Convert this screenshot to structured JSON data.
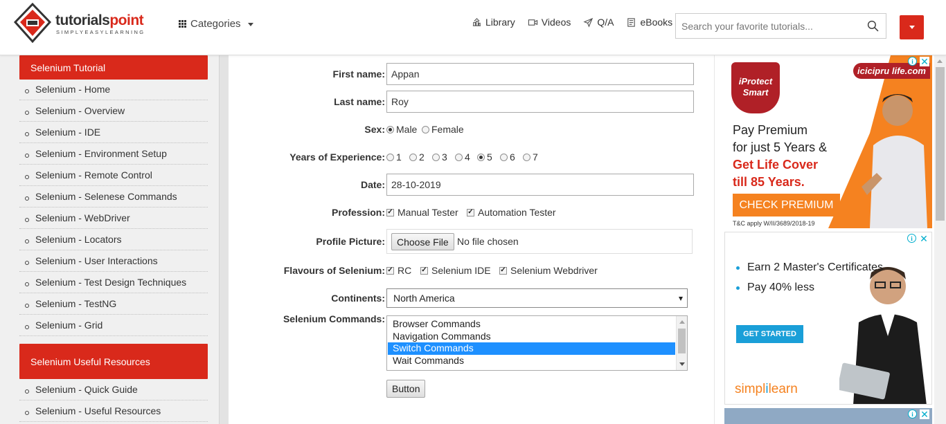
{
  "header": {
    "logo_main_a": "tutorials",
    "logo_main_b": "point",
    "logo_sub": "SIMPLYEASYLEARNING",
    "categories_label": "Categories",
    "nav": [
      {
        "label": "Library",
        "icon": "library-icon"
      },
      {
        "label": "Videos",
        "icon": "video-icon"
      },
      {
        "label": "Q/A",
        "icon": "send-icon"
      },
      {
        "label": "eBooks",
        "icon": "book-icon"
      }
    ],
    "search_placeholder": "Search your favorite tutorials..."
  },
  "sidebar": {
    "section1_title": "Selenium Tutorial",
    "items": [
      "Selenium - Home",
      "Selenium - Overview",
      "Selenium - IDE",
      "Selenium - Environment Setup",
      "Selenium - Remote Control",
      "Selenium - Selenese Commands",
      "Selenium - WebDriver",
      "Selenium - Locators",
      "Selenium - User Interactions",
      "Selenium - Test Design Techniques",
      "Selenium - TestNG",
      "Selenium - Grid"
    ],
    "section2_title": "Selenium Useful Resources",
    "resources": [
      "Selenium - Quick Guide",
      "Selenium - Useful Resources"
    ]
  },
  "form": {
    "first_name_label": "First name:",
    "first_name_value": "Appan",
    "last_name_label": "Last name:",
    "last_name_value": "Roy",
    "sex_label": "Sex:",
    "sex_options": [
      "Male",
      "Female"
    ],
    "sex_selected": "Male",
    "experience_label": "Years of Experience:",
    "experience_options": [
      "1",
      "2",
      "3",
      "4",
      "5",
      "6",
      "7"
    ],
    "experience_selected": "5",
    "date_label": "Date:",
    "date_value": "28-10-2019",
    "profession_label": "Profession:",
    "profession_options": [
      {
        "label": "Manual Tester",
        "checked": true
      },
      {
        "label": "Automation Tester",
        "checked": true
      }
    ],
    "profile_label": "Profile Picture:",
    "choose_file_label": "Choose File",
    "no_file_text": "No file chosen",
    "flavours_label": "Flavours of Selenium:",
    "flavours_options": [
      {
        "label": "RC",
        "checked": true
      },
      {
        "label": "Selenium IDE",
        "checked": true
      },
      {
        "label": "Selenium Webdriver",
        "checked": true
      }
    ],
    "continents_label": "Continents:",
    "continents_selected": "North America",
    "commands_label": "Selenium Commands:",
    "commands_options": [
      "Browser Commands",
      "Navigation Commands",
      "Switch Commands",
      "Wait Commands"
    ],
    "commands_selected": "Switch Commands",
    "button_label": "Button"
  },
  "ads": {
    "ad1_brand": "icicipru life.com",
    "ad1_shield": "iProtect Smart",
    "ad1_line1": "Pay Premium",
    "ad1_line2": "for just 5 Years &",
    "ad1_line3": "Get Life Cover",
    "ad1_line4": "till 85 Years.",
    "ad1_cta": "CHECK PREMIUM",
    "ad1_tc": "T&C apply W/II/3689/2018-19",
    "ad2_item1": "Earn 2 Master's Certificates",
    "ad2_item2": "Pay 40% less",
    "ad2_cta": "GET STARTED",
    "ad2_logo_a": "simpl",
    "ad2_logo_b": "i",
    "ad2_logo_c": "learn"
  },
  "colors": {
    "brand_red": "#d9291b",
    "selection_blue": "#1e90ff",
    "ad_orange": "#f58220",
    "ad_blue": "#1a9fd8"
  }
}
